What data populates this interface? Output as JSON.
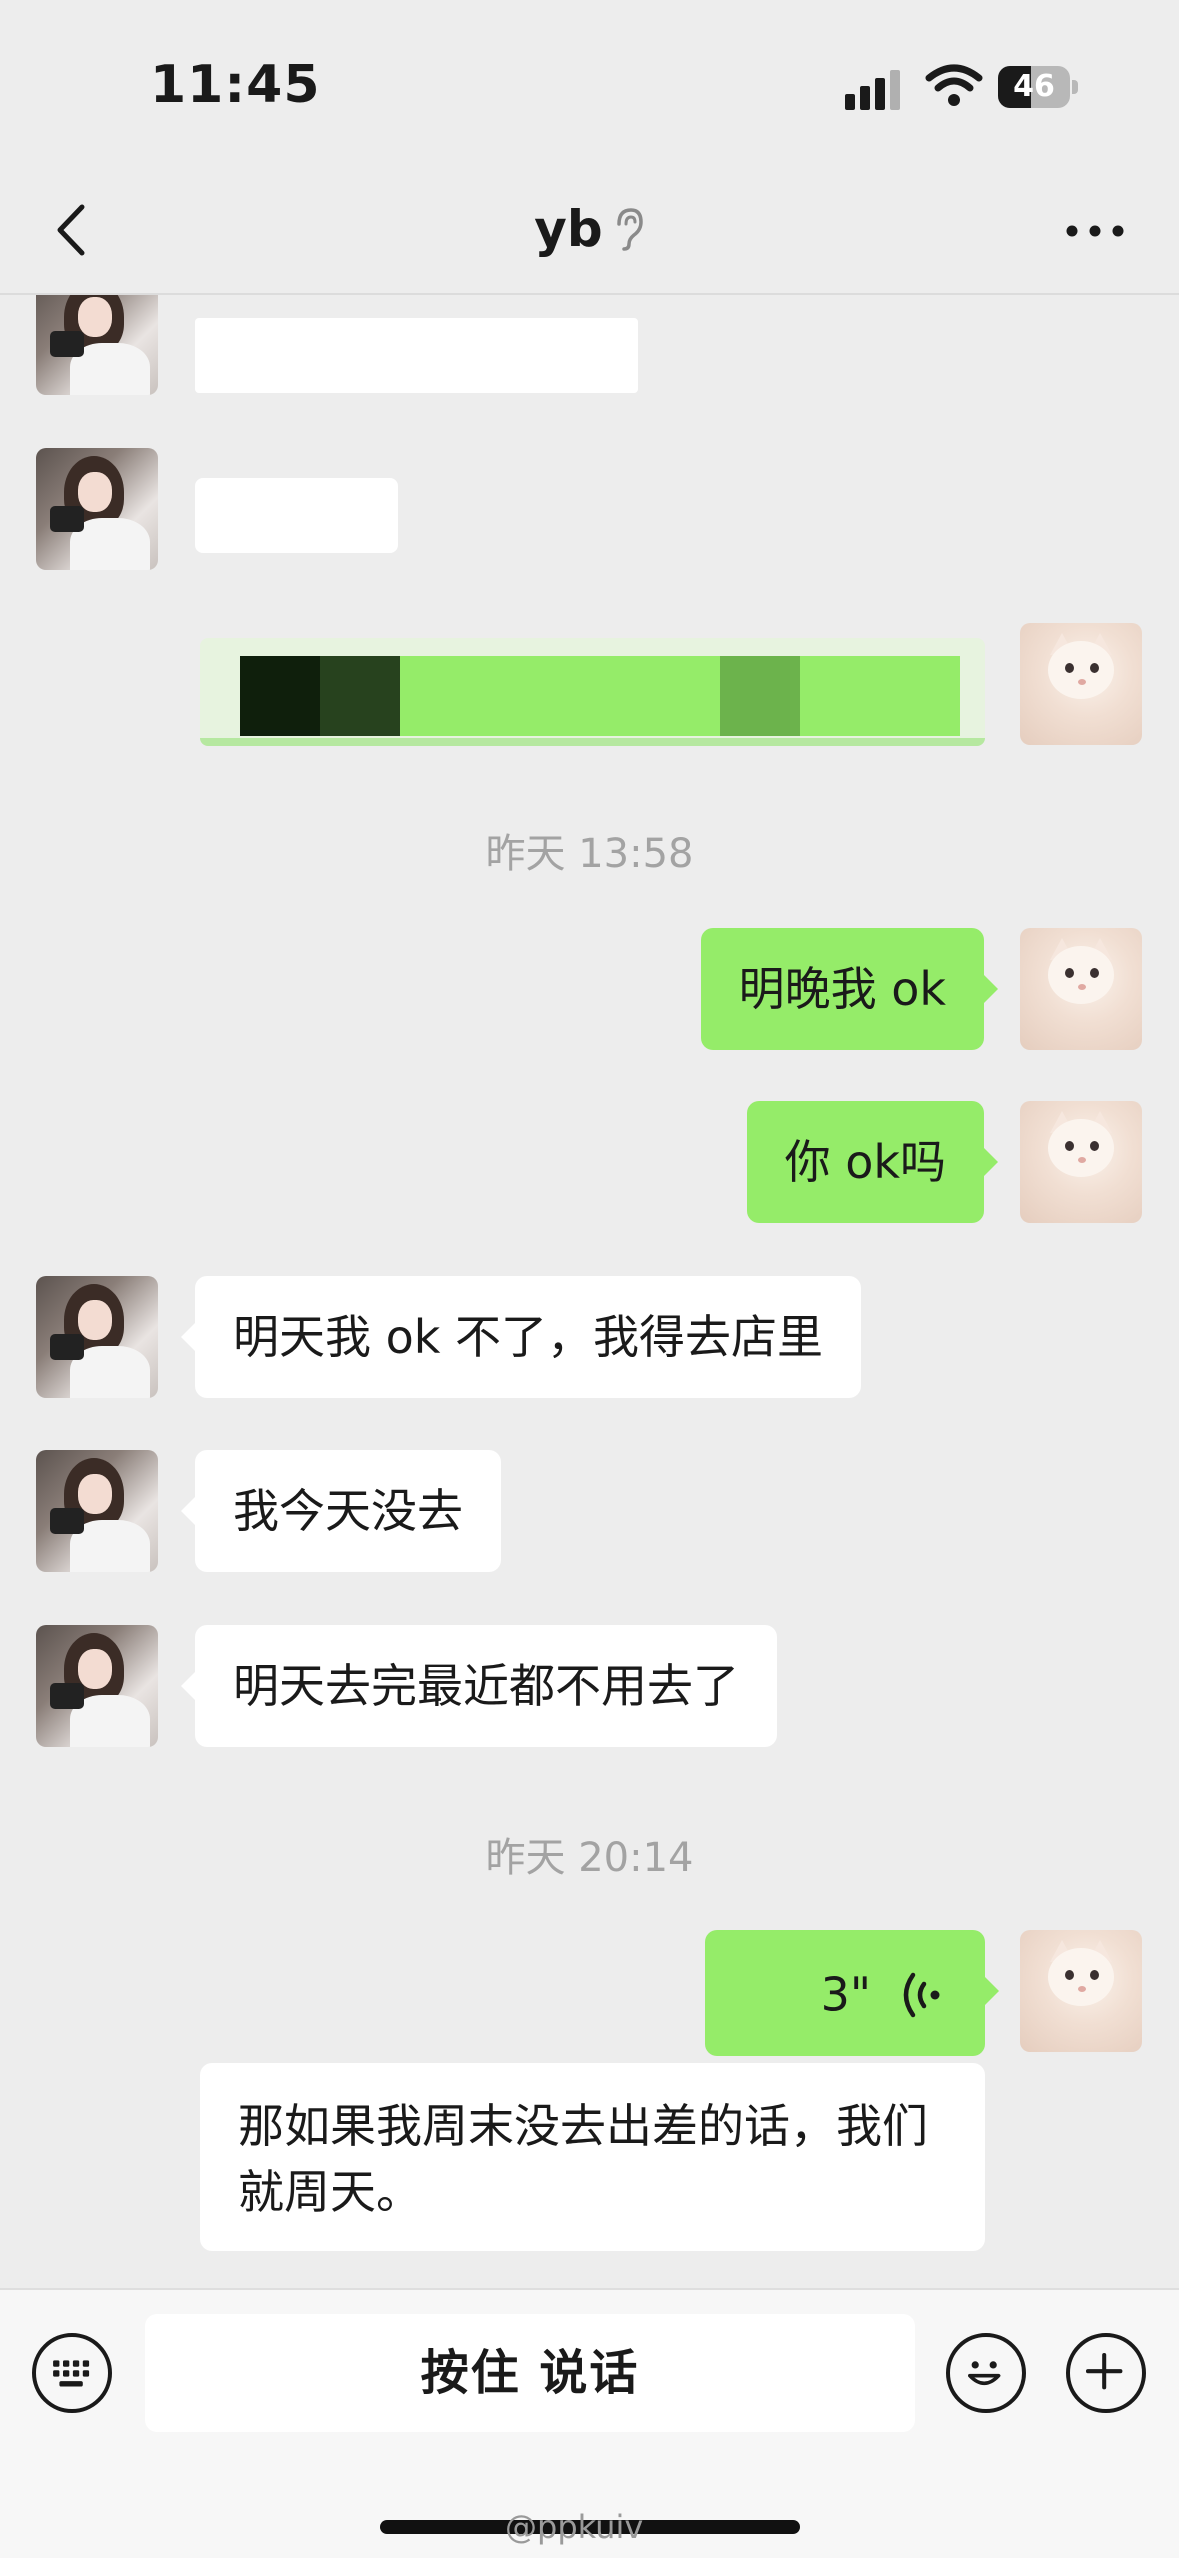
{
  "status_bar": {
    "time": "11:45",
    "battery_level": "46",
    "battery_fraction": 0.46
  },
  "nav": {
    "title": "yb",
    "back_icon": "chevron-left-icon",
    "ear_icon": "ear-icon",
    "more_icon": "more-dots-icon"
  },
  "messages": {
    "timestamp_1": "昨天 13:58",
    "m1": "明晚我 ok",
    "m2": "你 ok吗",
    "m3": "明天我 ok 不了，我得去店里",
    "m4": "我今天没去",
    "m5": "明天去完最近都不用去了",
    "timestamp_2": "昨天 20:14",
    "voice_duration": "3\"",
    "m7": "那如果我周末没去出差的话，我们就周天。"
  },
  "input_bar": {
    "talk_label": "按住 说话",
    "keyboard_icon": "keyboard-icon",
    "emoji_icon": "emoji-icon",
    "plus_icon": "plus-icon"
  },
  "watermark": "@ppkuiv",
  "colors": {
    "bubble_green": "#95ec69",
    "bubble_white": "#ffffff",
    "background": "#ededed"
  }
}
